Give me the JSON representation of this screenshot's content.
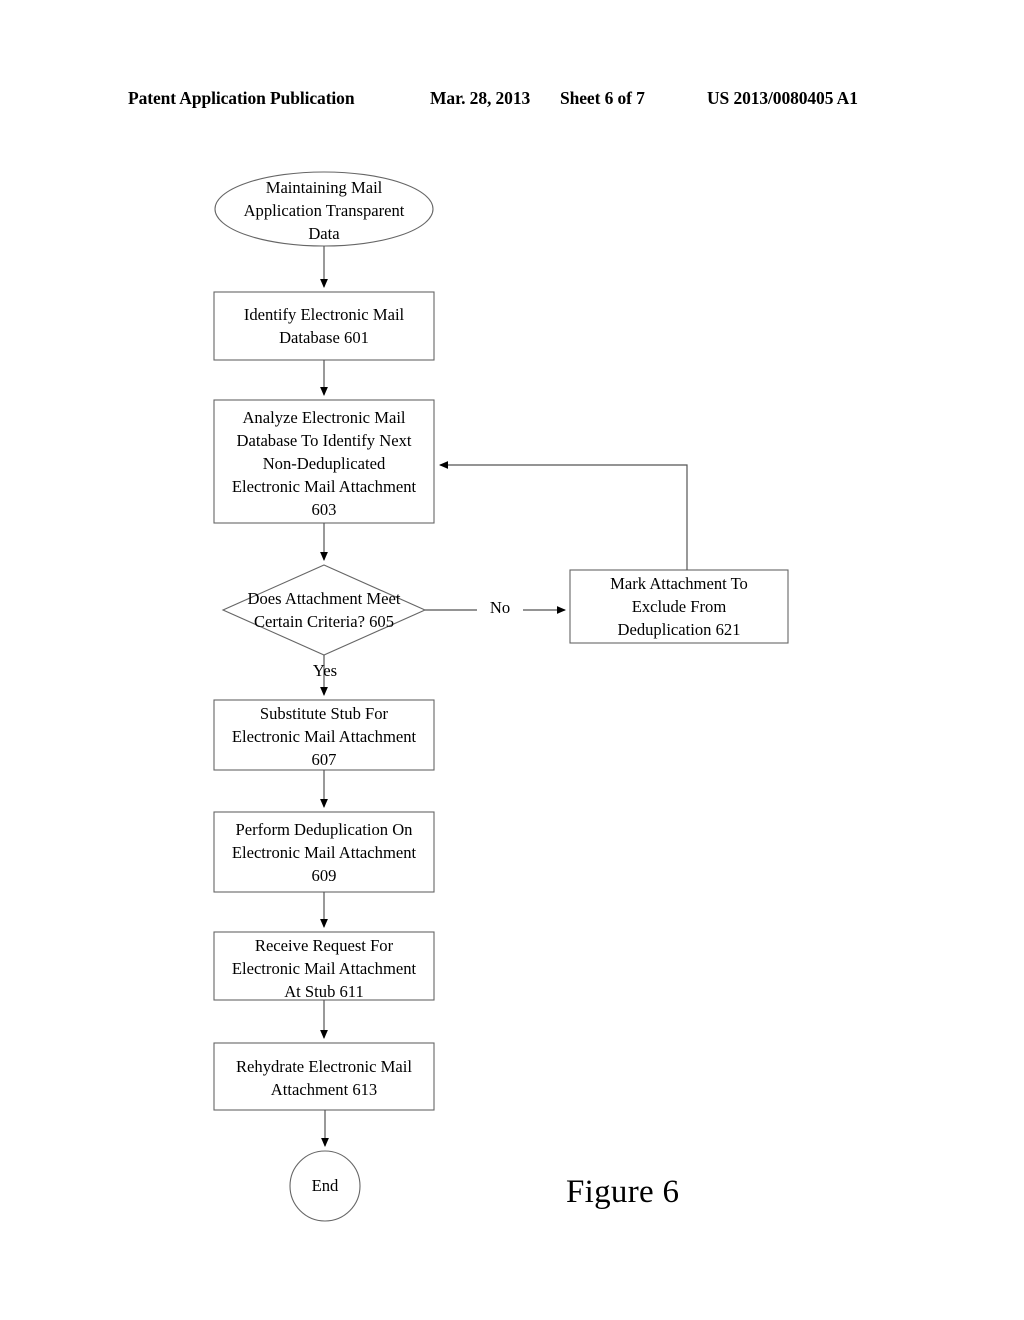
{
  "header": {
    "publication": "Patent Application Publication",
    "date": "Mar. 28, 2013",
    "sheet": "Sheet 6 of 7",
    "document_number": "US 2013/0080405 A1"
  },
  "figure": {
    "caption": "Figure 6"
  },
  "flowchart": {
    "type": "flowchart",
    "nodes": [
      {
        "id": "start",
        "shape": "ellipse",
        "label": "Maintaining Mail\nApplication Transparent\nData"
      },
      {
        "id": "step-601",
        "shape": "rectangle",
        "label": "Identify Electronic Mail\nDatabase 601",
        "reference": "601"
      },
      {
        "id": "step-603",
        "shape": "rectangle",
        "label": "Analyze Electronic Mail\nDatabase To Identify Next\nNon-Deduplicated\nElectronic Mail Attachment\n603",
        "reference": "603"
      },
      {
        "id": "decision-605",
        "shape": "diamond",
        "label": "Does Attachment Meet\nCertain Criteria? 605",
        "reference": "605"
      },
      {
        "id": "step-621",
        "shape": "rectangle",
        "label": "Mark Attachment To\nExclude From\nDeduplication 621",
        "reference": "621"
      },
      {
        "id": "step-607",
        "shape": "rectangle",
        "label": "Substitute Stub For\nElectronic Mail Attachment\n607",
        "reference": "607"
      },
      {
        "id": "step-609",
        "shape": "rectangle",
        "label": "Perform Deduplication On\nElectronic Mail Attachment\n609",
        "reference": "609"
      },
      {
        "id": "step-611",
        "shape": "rectangle",
        "label": "Receive Request For\nElectronic Mail Attachment\nAt Stub 611",
        "reference": "611"
      },
      {
        "id": "step-613",
        "shape": "rectangle",
        "label": "Rehydrate Electronic Mail\nAttachment 613",
        "reference": "613"
      },
      {
        "id": "end",
        "shape": "circle",
        "label": "End"
      }
    ],
    "edges": [
      {
        "from": "start",
        "to": "step-601",
        "label": ""
      },
      {
        "from": "step-601",
        "to": "step-603",
        "label": ""
      },
      {
        "from": "step-603",
        "to": "decision-605",
        "label": ""
      },
      {
        "from": "decision-605",
        "to": "step-621",
        "label": "No"
      },
      {
        "from": "decision-605",
        "to": "step-607",
        "label": "Yes"
      },
      {
        "from": "step-621",
        "to": "step-603",
        "label": ""
      },
      {
        "from": "step-607",
        "to": "step-609",
        "label": ""
      },
      {
        "from": "step-609",
        "to": "step-611",
        "label": ""
      },
      {
        "from": "step-611",
        "to": "step-613",
        "label": ""
      },
      {
        "from": "step-613",
        "to": "end",
        "label": ""
      }
    ],
    "edge_labels": {
      "no": "No",
      "yes": "Yes"
    }
  },
  "colors": {
    "ink": "#000000",
    "stroke": "#555555",
    "background": "#ffffff"
  }
}
